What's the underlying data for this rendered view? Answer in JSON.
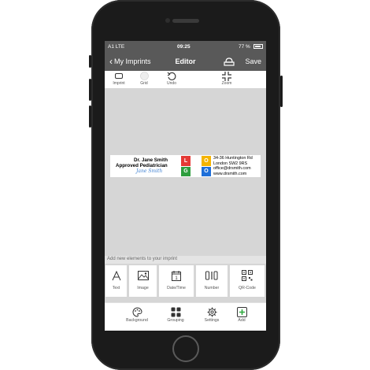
{
  "status": {
    "carrier": "A1  LTE",
    "time": "09:25",
    "battery": "77 %"
  },
  "nav": {
    "back_label": "My Imprints",
    "title": "Editor",
    "save_label": "Save"
  },
  "toolbar": {
    "imprint_label": "Imprint",
    "grid_label": "Grid",
    "undo_label": "Undo",
    "zoom_label": "Zoom"
  },
  "imprint": {
    "name_line1": "Dr. Jane Smith",
    "name_line2": "Approved Pediatrician",
    "signature": "Jane Smith",
    "logo_letters": [
      "L",
      "O",
      "G",
      "O"
    ],
    "address_lines": [
      "34-36 Huntington Rd",
      "London SW2 9RS",
      "office@drsmith.com",
      "www.drsmith.com"
    ]
  },
  "add_section": {
    "title": "Add new elements to your imprint",
    "items": [
      {
        "label": "Text",
        "icon": "text-a-icon"
      },
      {
        "label": "Image",
        "icon": "image-icon"
      },
      {
        "label": "Date/Time",
        "icon": "calendar-icon"
      },
      {
        "label": "Number",
        "icon": "number-icon"
      },
      {
        "label": "QR-Code",
        "icon": "qr-code-icon"
      }
    ]
  },
  "tabs": [
    {
      "label": "Background",
      "icon": "palette-icon"
    },
    {
      "label": "Grouping",
      "icon": "grid-squares-icon"
    },
    {
      "label": "Settings",
      "icon": "gear-icon"
    },
    {
      "label": "Add",
      "icon": "plus-square-icon"
    }
  ],
  "colors": {
    "nav_bg": "#595959",
    "canvas_bg": "#d6d6d6",
    "logo_red": "#e53935",
    "logo_yellow": "#f5b400",
    "logo_green": "#2e9e3e",
    "logo_blue": "#1e6fd9",
    "add_green": "#2eaa3f",
    "signature_blue": "#3d7fd1"
  }
}
